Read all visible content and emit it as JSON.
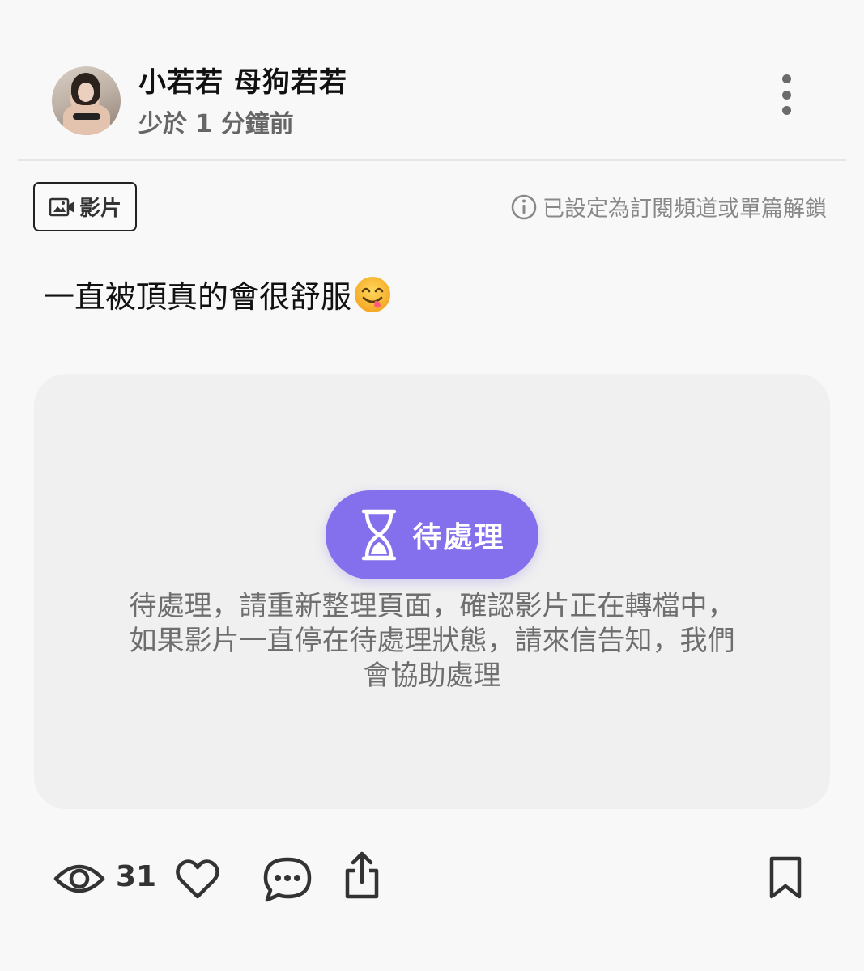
{
  "author": {
    "name": "小若若 母狗若若",
    "time": "少於 1 分鐘前"
  },
  "tag": {
    "label": "影片"
  },
  "notice": {
    "text": "已設定為訂閱頻道或單篇解鎖"
  },
  "post": {
    "text": "一直被頂真的會很舒服"
  },
  "media": {
    "status_label": "待處理",
    "message_lines": [
      "待處理，請重新整理頁面，確認影片正在轉檔中，",
      "如果影片一直停在待處理狀態，請來信告知，我們",
      "會協助處理"
    ]
  },
  "actions": {
    "view_count": "31"
  },
  "colors": {
    "accent": "#8470ec",
    "icon": "#333333",
    "muted_text": "#6e6e6e"
  },
  "icons": {
    "more": "more-vertical-icon",
    "video": "video-icon",
    "info": "info-icon",
    "emoji": "face-savoring-food-emoji",
    "hourglass": "hourglass-icon",
    "view": "eye-icon",
    "like": "heart-icon",
    "comment": "comment-icon",
    "share": "share-icon",
    "bookmark": "bookmark-icon"
  }
}
